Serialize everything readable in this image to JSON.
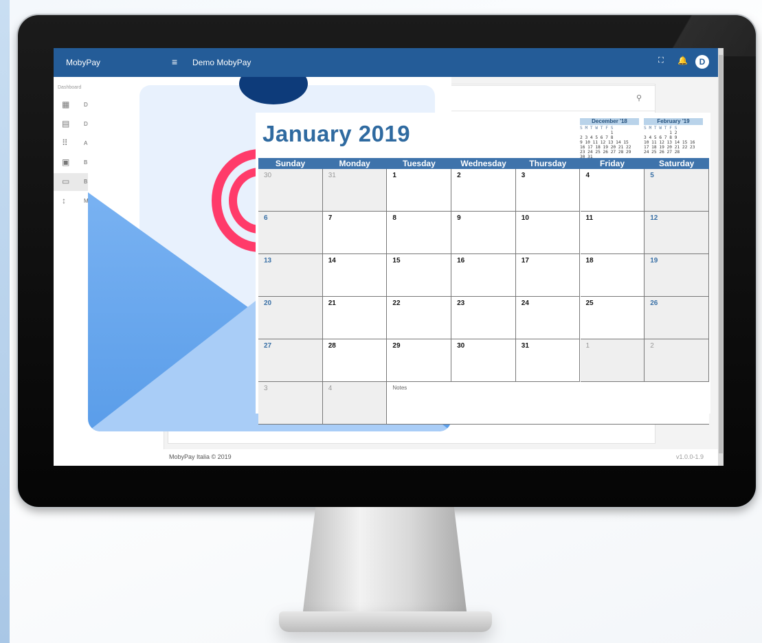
{
  "app": {
    "brand": "MobyPay",
    "menu_icon": "≡",
    "title": "Demo MobyPay",
    "expand_icon": "⛶",
    "bell_icon": "🔔",
    "avatar": "D",
    "footer": "MobyPay Italia © 2019",
    "version": "v1.0.0-1.9"
  },
  "sidebar": {
    "caption": "Dashboard",
    "items": [
      {
        "icon": "▦",
        "label": "D"
      },
      {
        "icon": "▤",
        "label": "D"
      },
      {
        "icon": "⠿",
        "label": "A"
      },
      {
        "icon": "▣",
        "label": "B"
      },
      {
        "icon": "▭",
        "label": "B"
      },
      {
        "icon": "↕",
        "label": "M"
      }
    ]
  },
  "calendar": {
    "title": "January 2019",
    "weekdays": [
      "Sunday",
      "Monday",
      "Tuesday",
      "Wednesday",
      "Thursday",
      "Friday",
      "Saturday"
    ],
    "notes_label": "Notes",
    "weeks": [
      [
        "30",
        "31",
        "1",
        "2",
        "3",
        "4",
        "5"
      ],
      [
        "6",
        "7",
        "8",
        "9",
        "10",
        "11",
        "12"
      ],
      [
        "13",
        "14",
        "15",
        "16",
        "17",
        "18",
        "19"
      ],
      [
        "20",
        "21",
        "22",
        "23",
        "24",
        "25",
        "26"
      ],
      [
        "27",
        "28",
        "29",
        "30",
        "31",
        "1",
        "2"
      ],
      [
        "3",
        "4",
        "",
        "",
        "",
        "",
        ""
      ]
    ],
    "mini_prev": {
      "title": "December '18",
      "dow": "S M T W T F S",
      "rows": [
        "            1",
        "2 3 4 5 6 7 8",
        "9 10 11 12 13 14 15",
        "16 17 18 19 20 21 22",
        "23 24 25 26 27 28 29",
        "30 31"
      ]
    },
    "mini_next": {
      "title": "February '19",
      "dow": "S M T W T F S",
      "rows": [
        "          1 2",
        "3 4 5 6 7 8 9",
        "10 11 12 13 14 15 16",
        "17 18 19 20 21 22 23",
        "24 25 26 27 28"
      ]
    }
  }
}
